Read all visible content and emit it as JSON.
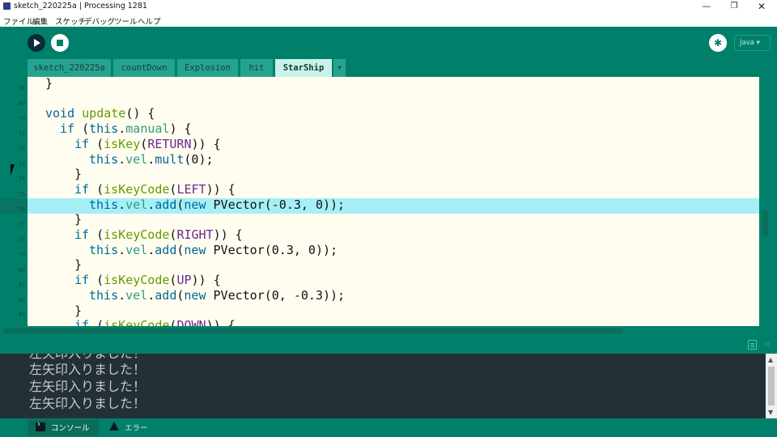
{
  "window": {
    "title": "sketch_220225a | Processing 1281",
    "minimize": "—",
    "maximize": "❐",
    "close": "✕"
  },
  "menu": [
    "ファイル",
    "編集",
    "スケッチ",
    "デバッグ",
    "ツール",
    "ヘルプ"
  ],
  "toolbar": {
    "run_icon": "play-icon",
    "stop_icon": "stop-icon",
    "debug_icon": "bug-icon",
    "mode": "Java ▾"
  },
  "tabs": [
    {
      "label": "sketch_220225a",
      "active": false
    },
    {
      "label": "countDown",
      "active": false
    },
    {
      "label": "Explosion",
      "active": false
    },
    {
      "label": "hit",
      "active": false
    },
    {
      "label": "StarShip",
      "active": true
    }
  ],
  "tab_menu": "▾",
  "editor": {
    "line_numbers": [
      "68",
      "69",
      "70",
      "71",
      "72",
      "73",
      "74",
      "75",
      "76",
      "77",
      "78",
      "79",
      "80",
      "81",
      "82",
      "83"
    ],
    "highlighted_line": "76",
    "code": [
      "}",
      "",
      "void update() {",
      "  if (this.manual) {",
      "    if (isKey(RETURN)) {",
      "      this.vel.mult(0);",
      "    }",
      "    if (isKeyCode(LEFT)) {",
      "      this.vel.add(new PVector(-0.3, 0));",
      "    }",
      "    if (isKeyCode(RIGHT)) {",
      "      this.vel.add(new PVector(0.3, 0));",
      "    }",
      "    if (isKeyCode(UP)) {",
      "      this.vel.add(new PVector(0, -0.3));",
      "    }",
      "    if (isKeyCode(DOWN)) {"
    ]
  },
  "console": {
    "lines": [
      "左矢印入りました！",
      "左矢印入りました！",
      "左矢印入りました！",
      "左矢印入りました！"
    ]
  },
  "footer": {
    "console_tab": "コンソール",
    "errors_tab": "エラー"
  },
  "colors": {
    "chrome": "#00806a",
    "editor_bg": "#fffdf0",
    "line_highlight": "#a6eff7",
    "console_bg": "#233136",
    "keyword": "#006699",
    "function": "#669900",
    "constant": "#6a2a8f"
  }
}
